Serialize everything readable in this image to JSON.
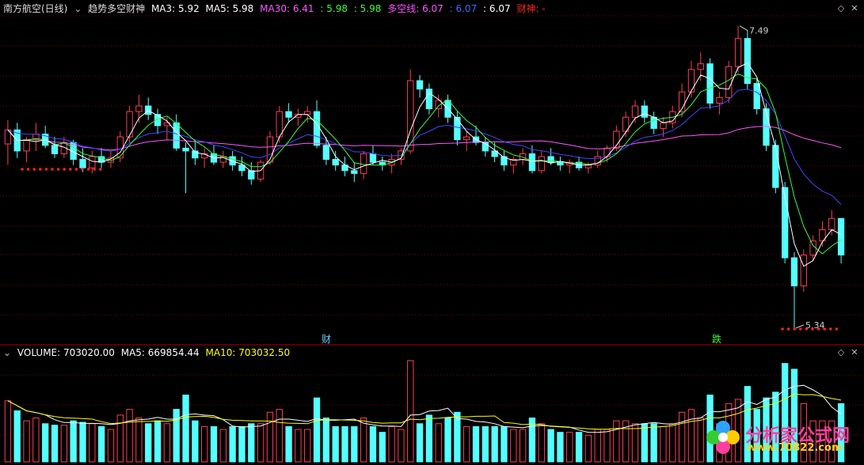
{
  "header": {
    "stock": "南方航空(日线)",
    "indicator_name": "趋势多空财神",
    "ma3": "MA3: 5.92",
    "ma5": "MA5: 5.98",
    "ma30": "MA30: 6.41",
    "val1": ": 5.98",
    "val2": ": 5.98",
    "duokong": "多空线: 6.07",
    "val3": ": 6.07",
    "val4": ": 6.07",
    "caishen": "财神: -"
  },
  "volume_header": {
    "volume": "VOLUME: 703020.00",
    "ma5": "MA5: 669854.44",
    "ma10": "MA10: 703032.50"
  },
  "annotations": {
    "high_label": "7.49",
    "low_label": "5.34",
    "signal_cai": "财",
    "signal_die": "跌"
  },
  "watermark": {
    "text": "分析家公式网",
    "url": "www.70822.com"
  },
  "colors": {
    "background": "#000000",
    "up": "#ff3b5c",
    "down": "#54ffff",
    "ma3": "#ffffff",
    "ma5": "#ffff00",
    "ma30": "#ff55ff",
    "duokong": "#33ff33",
    "blue_line": "#4444ff",
    "caishen": "#ff2222",
    "grid": "#7a0000"
  },
  "chart_data": [
    {
      "type": "candlestick",
      "title": "趋势多空财神",
      "ylim": [
        5.3,
        7.55
      ],
      "series": [
        {
          "name": "K",
          "x_count": 90,
          "ohlc": [
            [
              6.65,
              6.82,
              6.5,
              6.75
            ],
            [
              6.75,
              6.8,
              6.55,
              6.6
            ],
            [
              6.6,
              6.7,
              6.52,
              6.68
            ],
            [
              6.68,
              6.8,
              6.6,
              6.72
            ],
            [
              6.72,
              6.78,
              6.62,
              6.64
            ],
            [
              6.64,
              6.7,
              6.55,
              6.58
            ],
            [
              6.58,
              6.7,
              6.55,
              6.66
            ],
            [
              6.66,
              6.68,
              6.5,
              6.54
            ],
            [
              6.54,
              6.62,
              6.45,
              6.48
            ],
            [
              6.48,
              6.6,
              6.44,
              6.56
            ],
            [
              6.56,
              6.62,
              6.48,
              6.52
            ],
            [
              6.52,
              6.6,
              6.48,
              6.55
            ],
            [
              6.55,
              6.74,
              6.52,
              6.7
            ],
            [
              6.7,
              6.92,
              6.66,
              6.88
            ],
            [
              6.88,
              7.0,
              6.8,
              6.92
            ],
            [
              6.92,
              6.98,
              6.82,
              6.86
            ],
            [
              6.86,
              6.9,
              6.72,
              6.78
            ],
            [
              6.78,
              6.84,
              6.68,
              6.8
            ],
            [
              6.8,
              6.86,
              6.6,
              6.62
            ],
            [
              6.62,
              6.66,
              6.3,
              6.6
            ],
            [
              6.6,
              6.68,
              6.5,
              6.55
            ],
            [
              6.55,
              6.62,
              6.48,
              6.58
            ],
            [
              6.58,
              6.64,
              6.5,
              6.52
            ],
            [
              6.52,
              6.6,
              6.48,
              6.56
            ],
            [
              6.56,
              6.6,
              6.46,
              6.5
            ],
            [
              6.5,
              6.56,
              6.42,
              6.46
            ],
            [
              6.46,
              6.52,
              6.36,
              6.4
            ],
            [
              6.4,
              6.54,
              6.38,
              6.52
            ],
            [
              6.52,
              6.74,
              6.5,
              6.7
            ],
            [
              6.7,
              6.92,
              6.66,
              6.88
            ],
            [
              6.88,
              6.94,
              6.8,
              6.84
            ],
            [
              6.84,
              6.9,
              6.78,
              6.86
            ],
            [
              6.86,
              6.92,
              6.8,
              6.88
            ],
            [
              6.88,
              6.96,
              6.62,
              6.64
            ],
            [
              6.64,
              6.7,
              6.5,
              6.54
            ],
            [
              6.54,
              6.6,
              6.46,
              6.5
            ],
            [
              6.5,
              6.56,
              6.42,
              6.46
            ],
            [
              6.46,
              6.52,
              6.38,
              6.44
            ],
            [
              6.44,
              6.6,
              6.4,
              6.58
            ],
            [
              6.58,
              6.64,
              6.5,
              6.52
            ],
            [
              6.52,
              6.56,
              6.46,
              6.5
            ],
            [
              6.5,
              6.58,
              6.44,
              6.54
            ],
            [
              6.54,
              6.62,
              6.5,
              6.6
            ],
            [
              6.6,
              7.18,
              6.58,
              7.1
            ],
            [
              7.1,
              7.14,
              6.98,
              7.04
            ],
            [
              7.04,
              7.08,
              6.86,
              6.9
            ],
            [
              6.9,
              7.0,
              6.84,
              6.96
            ],
            [
              6.96,
              7.0,
              6.8,
              6.84
            ],
            [
              6.84,
              6.88,
              6.64,
              6.68
            ],
            [
              6.68,
              6.74,
              6.6,
              6.7
            ],
            [
              6.7,
              6.78,
              6.64,
              6.66
            ],
            [
              6.66,
              6.7,
              6.56,
              6.6
            ],
            [
              6.6,
              6.66,
              6.52,
              6.56
            ],
            [
              6.56,
              6.6,
              6.46,
              6.5
            ],
            [
              6.5,
              6.56,
              6.44,
              6.54
            ],
            [
              6.54,
              6.62,
              6.5,
              6.58
            ],
            [
              6.58,
              6.64,
              6.44,
              6.46
            ],
            [
              6.46,
              6.6,
              6.44,
              6.56
            ],
            [
              6.56,
              6.62,
              6.5,
              6.52
            ],
            [
              6.52,
              6.56,
              6.46,
              6.5
            ],
            [
              6.5,
              6.54,
              6.44,
              6.52
            ],
            [
              6.52,
              6.56,
              6.46,
              6.48
            ],
            [
              6.48,
              6.52,
              6.44,
              6.5
            ],
            [
              6.5,
              6.6,
              6.48,
              6.56
            ],
            [
              6.56,
              6.64,
              6.52,
              6.62
            ],
            [
              6.62,
              6.78,
              6.6,
              6.74
            ],
            [
              6.74,
              6.88,
              6.7,
              6.84
            ],
            [
              6.84,
              6.96,
              6.8,
              6.92
            ],
            [
              6.92,
              6.96,
              6.8,
              6.84
            ],
            [
              6.84,
              6.88,
              6.72,
              6.76
            ],
            [
              6.76,
              6.84,
              6.7,
              6.8
            ],
            [
              6.8,
              6.92,
              6.76,
              6.88
            ],
            [
              6.88,
              7.08,
              6.84,
              7.02
            ],
            [
              7.02,
              7.24,
              6.98,
              7.18
            ],
            [
              7.18,
              7.3,
              7.1,
              7.22
            ],
            [
              7.22,
              7.26,
              6.9,
              6.94
            ],
            [
              6.94,
              7.02,
              6.86,
              6.98
            ],
            [
              6.98,
              7.24,
              6.94,
              7.2
            ],
            [
              7.2,
              7.49,
              7.16,
              7.4
            ],
            [
              7.4,
              7.46,
              7.04,
              7.08
            ],
            [
              7.08,
              7.12,
              6.86,
              6.9
            ],
            [
              6.9,
              6.94,
              6.6,
              6.64
            ],
            [
              6.64,
              6.68,
              6.3,
              6.34
            ],
            [
              6.34,
              6.38,
              5.8,
              5.84
            ],
            [
              5.84,
              5.88,
              5.34,
              5.64
            ],
            [
              5.64,
              5.9,
              5.6,
              5.86
            ],
            [
              5.86,
              6.0,
              5.82,
              5.96
            ],
            [
              5.96,
              6.1,
              5.92,
              6.04
            ],
            [
              6.04,
              6.18,
              6.0,
              6.12
            ],
            [
              6.12,
              6.1,
              5.8,
              5.86
            ]
          ]
        },
        {
          "name": "MA3"
        },
        {
          "name": "MA5"
        },
        {
          "name": "MA30"
        },
        {
          "name": "多空线"
        }
      ],
      "high": 7.49,
      "low": 5.34
    },
    {
      "type": "bar",
      "title": "VOLUME",
      "series": [
        {
          "name": "VOLUME"
        },
        {
          "name": "MA5"
        },
        {
          "name": "MA10"
        }
      ],
      "last_volume": 703020.0,
      "ma5": 669854.44,
      "ma10": 703032.5
    }
  ]
}
